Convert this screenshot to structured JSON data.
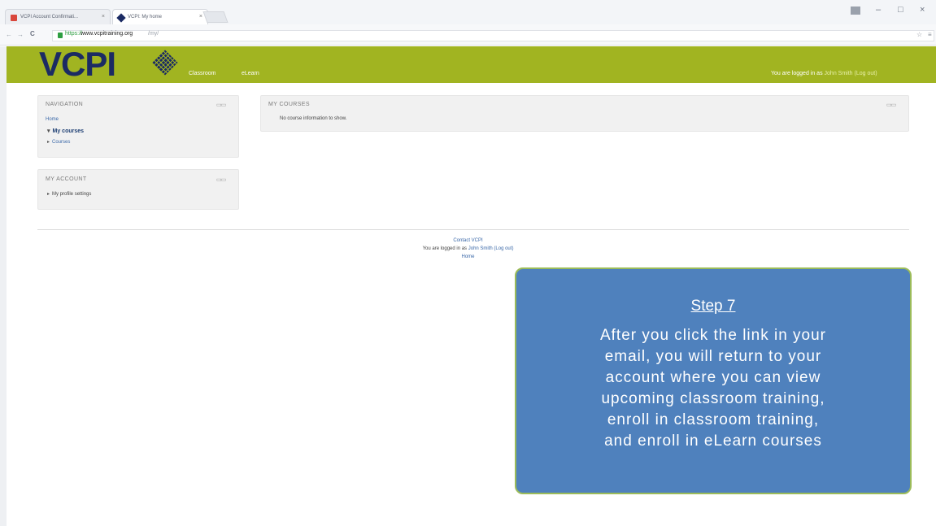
{
  "browser": {
    "tabs": [
      {
        "label": "VCPI Account Confirmati...",
        "active": false
      },
      {
        "label": "VCPI: My home",
        "active": true
      }
    ],
    "url": {
      "scheme": "https://",
      "host": "www.vcpitraining.org",
      "path": "/my/"
    },
    "window_controls": {
      "minimize": "–",
      "maximize": "□",
      "close": "×"
    },
    "nav": {
      "back": "←",
      "forward": "→",
      "reload": "C"
    }
  },
  "header": {
    "logo": "VCPI",
    "nav": [
      "Classroom",
      "eLearn"
    ],
    "login_prefix": "You are logged in as",
    "user": "John Smith",
    "logout": "(Log out)"
  },
  "navigation_block": {
    "title": "NAVIGATION",
    "home": "Home",
    "items": [
      "My courses",
      "Courses"
    ]
  },
  "account_block": {
    "title": "MY ACCOUNT",
    "items": [
      "My profile settings"
    ]
  },
  "courses_block": {
    "title": "MY COURSES",
    "empty": "No course information to show."
  },
  "footer": {
    "contact": "Contact VCPI",
    "login_prefix": "You are logged in as",
    "user": "John Smith",
    "logout": "(Log out)",
    "home": "Home"
  },
  "callout": {
    "title": "Step 7",
    "lines": [
      "After you click the link in your",
      "email, you will return to your",
      "account where you can view",
      "upcoming classroom training,",
      "enroll in classroom training,",
      "and enroll in eLearn courses"
    ]
  },
  "colors": {
    "header_bg": "#a1b421",
    "logo": "#1b2b63",
    "callout_bg": "#4f81bd",
    "callout_border": "#9bbb59",
    "link": "#3a68a8"
  }
}
